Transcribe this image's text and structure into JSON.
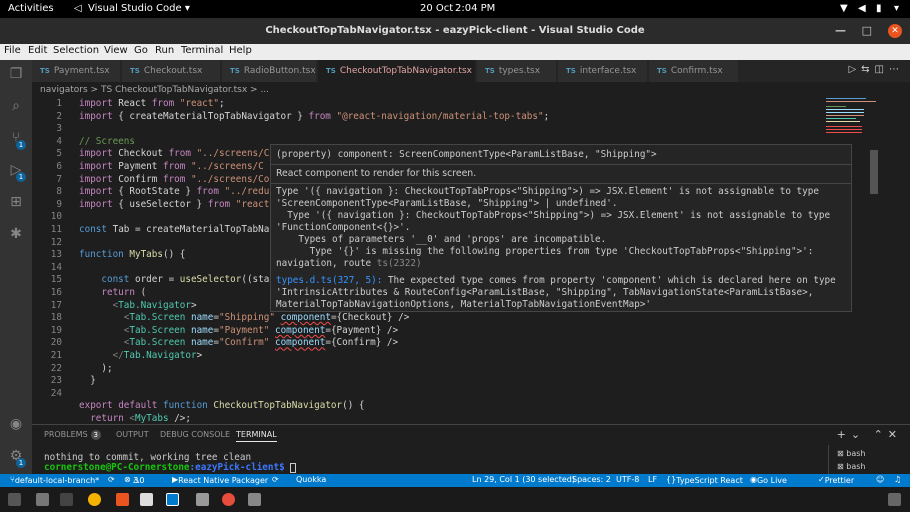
{
  "system": {
    "activities": "Activities",
    "app": "Visual Studio Code",
    "date": "20 Oct",
    "time": "2:04 PM"
  },
  "window": {
    "title": "CheckoutTopTabNavigator.tsx - eazyPick-client - Visual Studio Code"
  },
  "menu": [
    "File",
    "Edit",
    "Selection",
    "View",
    "Go",
    "Run",
    "Terminal",
    "Help"
  ],
  "tabs": [
    {
      "label": "Payment.tsx"
    },
    {
      "label": "Checkout.tsx"
    },
    {
      "label": "RadioButton.tsx"
    },
    {
      "label": "CheckoutTopTabNavigator.tsx 3, M",
      "active": true
    },
    {
      "label": "types.tsx"
    },
    {
      "label": "interface.tsx"
    },
    {
      "label": "Confirm.tsx"
    }
  ],
  "file_icon": "TS",
  "breadcrumb": "navigators > TS CheckoutTopTabNavigator.tsx > ...",
  "line_numbers": [
    "1",
    "2",
    "3",
    "4",
    "5",
    "6",
    "7",
    "8",
    "9",
    "10",
    "11",
    "12",
    "13",
    "14",
    "15",
    "16",
    "17",
    "18",
    "19",
    "20",
    "21",
    "22",
    "23",
    "24"
  ],
  "code_lines": [
    "import React from \"react\";",
    "import { createMaterialTopTabNavigator } from \"@react-navigation/material-top-tabs\";",
    "",
    "// Screens",
    "import Checkout from \"../screens/C",
    "import Payment from \"../screens/C",
    "import Confirm from \"../screens/Co",
    "import { RootState } from \"../redu",
    "import { useSelector } from \"react",
    "",
    "const Tab = createMaterialTopTabNa",
    "",
    "function MyTabs() {",
    "",
    "    const order = useSelector((sta",
    "    return (",
    "      <Tab.Navigator>",
    "        <Tab.Screen name=\"Shipping\" component={Checkout} />",
    "        <Tab.Screen name=\"Payment\" component={Payment} />",
    "        <Tab.Screen name=\"Confirm\" component={Confirm} />",
    "      </Tab.Navigator>",
    "    );",
    "  }",
    "",
    "export default function CheckoutTopTabNavigator() {",
    "  return <MyTabs />;"
  ],
  "hover": {
    "signature": "(property) component: ScreenComponentType<ParamListBase, \"Shipping\">",
    "doc": "React component to render for this screen.",
    "error_lines": [
      "Type '({ navigation }: CheckoutTopTabProps<\"Shipping\">) => JSX.Element' is not assignable to type",
      "'ScreenComponentType<ParamListBase, \"Shipping\"> | undefined'.",
      "  Type '({ navigation }: CheckoutTopTabProps<\"Shipping\">) => JSX.Element' is not assignable to type",
      "'FunctionComponent<{}>'.",
      "    Types of parameters '__0' and 'props' are incompatible.",
      "      Type '{}' is missing the following properties from type 'CheckoutTopTabProps<\"Shipping\">':",
      "navigation, route"
    ],
    "error_code": "ts(2322)",
    "related_link": "types.d.ts(327, 5):",
    "related_lines": [
      " The expected type comes from property 'component' which is declared here on type",
      "'IntrinsicAttributes & RouteConfig<ParamListBase, \"Shipping\", TabNavigationState<ParamListBase>,",
      "MaterialTopTabNavigationOptions, MaterialTopTabNavigationEventMap>'"
    ]
  },
  "panel": {
    "tabs": [
      "PROBLEMS",
      "OUTPUT",
      "DEBUG CONSOLE",
      "TERMINAL"
    ],
    "problems_count": "3",
    "terminal_lines": [
      "nothing to commit, working tree clean"
    ],
    "prompt_user": "cornerstone@PC-Cornerstone",
    "prompt_path": ":eazyPick-client$",
    "terminals": [
      "bash",
      "bash"
    ]
  },
  "status": {
    "branch": "default-local-branch*",
    "errors": "3",
    "warnings": "0",
    "packager": "React Native Packager",
    "quokka": "Quokka",
    "position": "Ln 29, Col 1 (30 selected)",
    "spaces": "Spaces: 2",
    "encoding": "UTF-8",
    "eol": "LF",
    "language": "TypeScript React",
    "golive": "Go Live",
    "prettier": "Prettier"
  },
  "colors": {
    "accent": "#007acc",
    "error": "#f14c4c",
    "active_tab_text": "#e2a4a4"
  }
}
